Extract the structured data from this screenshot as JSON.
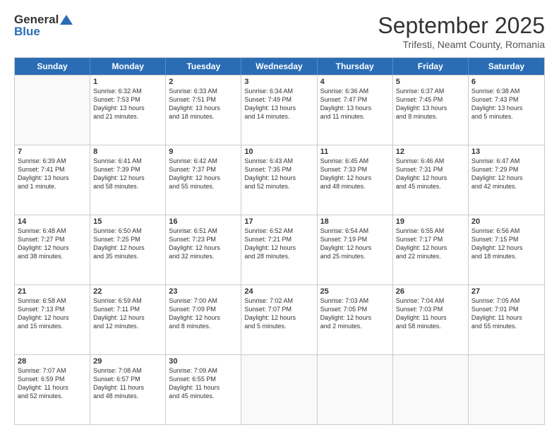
{
  "logo": {
    "line1": "General",
    "line2": "Blue"
  },
  "title": "September 2025",
  "subtitle": "Trifesti, Neamt County, Romania",
  "header_days": [
    "Sunday",
    "Monday",
    "Tuesday",
    "Wednesday",
    "Thursday",
    "Friday",
    "Saturday"
  ],
  "weeks": [
    [
      {
        "day": "",
        "info": ""
      },
      {
        "day": "1",
        "info": "Sunrise: 6:32 AM\nSunset: 7:53 PM\nDaylight: 13 hours\nand 21 minutes."
      },
      {
        "day": "2",
        "info": "Sunrise: 6:33 AM\nSunset: 7:51 PM\nDaylight: 13 hours\nand 18 minutes."
      },
      {
        "day": "3",
        "info": "Sunrise: 6:34 AM\nSunset: 7:49 PM\nDaylight: 13 hours\nand 14 minutes."
      },
      {
        "day": "4",
        "info": "Sunrise: 6:36 AM\nSunset: 7:47 PM\nDaylight: 13 hours\nand 11 minutes."
      },
      {
        "day": "5",
        "info": "Sunrise: 6:37 AM\nSunset: 7:45 PM\nDaylight: 13 hours\nand 8 minutes."
      },
      {
        "day": "6",
        "info": "Sunrise: 6:38 AM\nSunset: 7:43 PM\nDaylight: 13 hours\nand 5 minutes."
      }
    ],
    [
      {
        "day": "7",
        "info": "Sunrise: 6:39 AM\nSunset: 7:41 PM\nDaylight: 13 hours\nand 1 minute."
      },
      {
        "day": "8",
        "info": "Sunrise: 6:41 AM\nSunset: 7:39 PM\nDaylight: 12 hours\nand 58 minutes."
      },
      {
        "day": "9",
        "info": "Sunrise: 6:42 AM\nSunset: 7:37 PM\nDaylight: 12 hours\nand 55 minutes."
      },
      {
        "day": "10",
        "info": "Sunrise: 6:43 AM\nSunset: 7:35 PM\nDaylight: 12 hours\nand 52 minutes."
      },
      {
        "day": "11",
        "info": "Sunrise: 6:45 AM\nSunset: 7:33 PM\nDaylight: 12 hours\nand 48 minutes."
      },
      {
        "day": "12",
        "info": "Sunrise: 6:46 AM\nSunset: 7:31 PM\nDaylight: 12 hours\nand 45 minutes."
      },
      {
        "day": "13",
        "info": "Sunrise: 6:47 AM\nSunset: 7:29 PM\nDaylight: 12 hours\nand 42 minutes."
      }
    ],
    [
      {
        "day": "14",
        "info": "Sunrise: 6:48 AM\nSunset: 7:27 PM\nDaylight: 12 hours\nand 38 minutes."
      },
      {
        "day": "15",
        "info": "Sunrise: 6:50 AM\nSunset: 7:25 PM\nDaylight: 12 hours\nand 35 minutes."
      },
      {
        "day": "16",
        "info": "Sunrise: 6:51 AM\nSunset: 7:23 PM\nDaylight: 12 hours\nand 32 minutes."
      },
      {
        "day": "17",
        "info": "Sunrise: 6:52 AM\nSunset: 7:21 PM\nDaylight: 12 hours\nand 28 minutes."
      },
      {
        "day": "18",
        "info": "Sunrise: 6:54 AM\nSunset: 7:19 PM\nDaylight: 12 hours\nand 25 minutes."
      },
      {
        "day": "19",
        "info": "Sunrise: 6:55 AM\nSunset: 7:17 PM\nDaylight: 12 hours\nand 22 minutes."
      },
      {
        "day": "20",
        "info": "Sunrise: 6:56 AM\nSunset: 7:15 PM\nDaylight: 12 hours\nand 18 minutes."
      }
    ],
    [
      {
        "day": "21",
        "info": "Sunrise: 6:58 AM\nSunset: 7:13 PM\nDaylight: 12 hours\nand 15 minutes."
      },
      {
        "day": "22",
        "info": "Sunrise: 6:59 AM\nSunset: 7:11 PM\nDaylight: 12 hours\nand 12 minutes."
      },
      {
        "day": "23",
        "info": "Sunrise: 7:00 AM\nSunset: 7:09 PM\nDaylight: 12 hours\nand 8 minutes."
      },
      {
        "day": "24",
        "info": "Sunrise: 7:02 AM\nSunset: 7:07 PM\nDaylight: 12 hours\nand 5 minutes."
      },
      {
        "day": "25",
        "info": "Sunrise: 7:03 AM\nSunset: 7:05 PM\nDaylight: 12 hours\nand 2 minutes."
      },
      {
        "day": "26",
        "info": "Sunrise: 7:04 AM\nSunset: 7:03 PM\nDaylight: 11 hours\nand 58 minutes."
      },
      {
        "day": "27",
        "info": "Sunrise: 7:05 AM\nSunset: 7:01 PM\nDaylight: 11 hours\nand 55 minutes."
      }
    ],
    [
      {
        "day": "28",
        "info": "Sunrise: 7:07 AM\nSunset: 6:59 PM\nDaylight: 11 hours\nand 52 minutes."
      },
      {
        "day": "29",
        "info": "Sunrise: 7:08 AM\nSunset: 6:57 PM\nDaylight: 11 hours\nand 48 minutes."
      },
      {
        "day": "30",
        "info": "Sunrise: 7:09 AM\nSunset: 6:55 PM\nDaylight: 11 hours\nand 45 minutes."
      },
      {
        "day": "",
        "info": ""
      },
      {
        "day": "",
        "info": ""
      },
      {
        "day": "",
        "info": ""
      },
      {
        "day": "",
        "info": ""
      }
    ]
  ]
}
